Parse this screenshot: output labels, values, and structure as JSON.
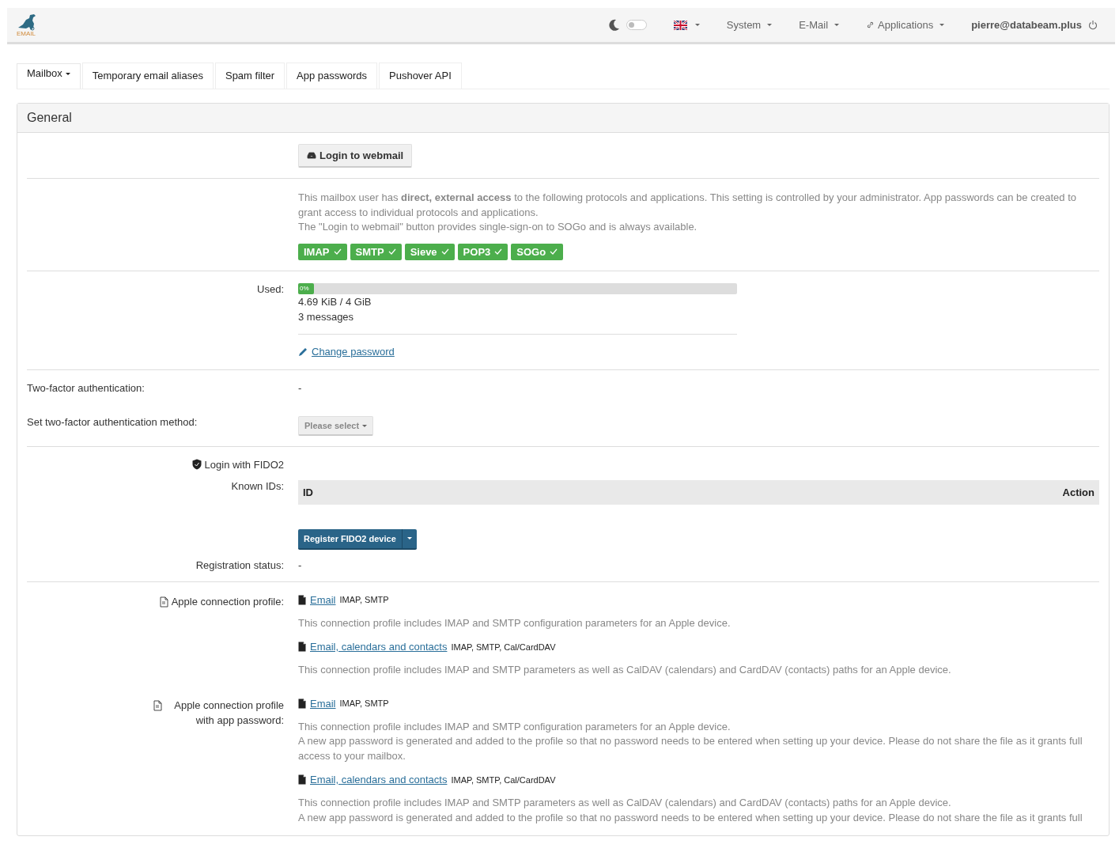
{
  "navbar": {
    "logo_text": "EMAIL",
    "dark_mode": {
      "on": false
    },
    "language": {
      "has_menu": true
    },
    "menus": [
      {
        "label": "System",
        "kind": "plain"
      },
      {
        "label": "E-Mail",
        "kind": "plain"
      },
      {
        "label": "Applications",
        "kind": "link"
      }
    ],
    "user": "pierre@databeam.plus"
  },
  "tabs": [
    {
      "label": "Mailbox",
      "selected": true,
      "dropdown": true
    },
    {
      "label": "Temporary email aliases",
      "selected": false,
      "dropdown": false
    },
    {
      "label": "Spam filter",
      "selected": false,
      "dropdown": false
    },
    {
      "label": "App passwords",
      "selected": false,
      "dropdown": false
    },
    {
      "label": "Pushover API",
      "selected": false,
      "dropdown": false
    }
  ],
  "panel": {
    "title": "General",
    "webmail_button": "Login to webmail",
    "access": {
      "text": "This mailbox user has **direct, external access** to the following protocols and applications. This setting is controlled by your administrator. App passwords can be created to grant access to individual protocols and applications.",
      "note": "The \"Login to webmail\" button provides single-sign-on to SOGo and is always available.",
      "protocols": [
        {
          "label": "IMAP",
          "enabled": true
        },
        {
          "label": "SMTP",
          "enabled": true
        },
        {
          "label": "Sieve",
          "enabled": true
        },
        {
          "label": "POP3",
          "enabled": true
        },
        {
          "label": "SOGo",
          "enabled": true
        }
      ]
    },
    "usage": {
      "label": "Used:",
      "level": 0,
      "percent": "0%",
      "size": "4.69 KiB / 4 GiB",
      "messages": "3 messages",
      "change_password": "Change password"
    },
    "two_factor": {
      "label": "Two-factor authentication:",
      "value": "-"
    },
    "two_factor_method": {
      "label": "Set two-factor authentication method:",
      "placeholder": "Please select"
    },
    "fido2": {
      "title": "Login with FIDO2",
      "known_ids_label": "Known IDs:",
      "columns": [
        "ID",
        "Action"
      ],
      "register_button": "Register FIDO2 device",
      "status_label": "Registration status:",
      "status_value": "-"
    },
    "profiles": [
      {
        "label": "Apple connection profile:",
        "items": [
          {
            "link": "Email",
            "protocols": "IMAP, SMTP",
            "description": [
              "This connection profile includes IMAP and SMTP configuration parameters for an Apple device."
            ]
          },
          {
            "link": "Email, calendars and contacts",
            "protocols": "IMAP, SMTP, Cal/CardDAV",
            "description": [
              "This connection profile includes IMAP and SMTP parameters as well as CalDAV (calendars) and CardDAV (contacts) paths for an Apple device."
            ]
          }
        ]
      },
      {
        "label": "Apple connection profile with app password:",
        "items": [
          {
            "link": "Email",
            "protocols": "IMAP, SMTP",
            "description": [
              "This connection profile includes IMAP and SMTP configuration parameters for an Apple device.",
              "A new app password is generated and added to the profile so that no password needs to be entered when setting up your device. Please do not share the file as it grants full access to your mailbox."
            ]
          },
          {
            "link": "Email, calendars and contacts",
            "protocols": "IMAP, SMTP, Cal/CardDAV",
            "description": [
              "This connection profile includes IMAP and SMTP parameters as well as CalDAV (calendars) and CardDAV (contacts) paths for an Apple device.",
              "A new app password is generated and added to the profile so that no password needs to be entered when setting up your device. Please do not share the file as it grants full"
            ]
          }
        ]
      }
    ]
  }
}
